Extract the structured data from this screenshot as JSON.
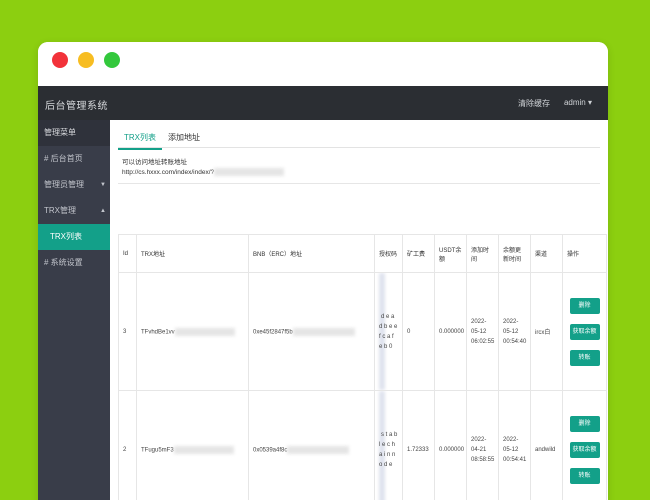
{
  "window": {
    "controls": [
      "close",
      "minimize",
      "maximize"
    ]
  },
  "topnav": {
    "brand": "后台管理系统",
    "links": [
      "清除缓存",
      "admin ▾"
    ]
  },
  "sidebar": {
    "items": [
      {
        "label": "管理菜单",
        "type": "head"
      },
      {
        "label": "# 后台首页"
      },
      {
        "label": "管理员管理",
        "caret": "▼"
      },
      {
        "label": "TRX管理",
        "caret": "▲"
      },
      {
        "label": "TRX列表",
        "type": "sub"
      },
      {
        "label": "# 系统设置"
      }
    ]
  },
  "tabs": [
    {
      "label": "TRX列表",
      "active": true
    },
    {
      "label": "添加地址"
    }
  ],
  "address": {
    "label": "可以访问地址转账地址",
    "url": "http://cs.hxxx.com/index/index/?"
  },
  "table": {
    "columns": [
      "Id",
      "TRX地址",
      "BNB（ERC）地址",
      "授权码",
      "矿工费",
      "USDT余额",
      "添加时间",
      "余额更新时间",
      "渠道",
      "操作"
    ],
    "rows": [
      {
        "id": "3",
        "trx": "TFvhdBe1vv",
        "bnb": "0xe45f2847f5b",
        "auth": "d e a d b e e f c a f e b 0",
        "fee": "0",
        "usdt": "0.000000",
        "added": "2022-05-12 06:02:55",
        "updated": "2022-05-12 00:54:40",
        "channel": "ircx白",
        "actions": [
          "删除",
          "获取余额",
          "转账"
        ]
      },
      {
        "id": "2",
        "trx": "TFugu5mF3",
        "bnb": "0x0539a4f8c",
        "auth": "s t a b l e c h a i n n o d e",
        "fee": "1.72333",
        "usdt": "0.000000",
        "added": "2022-04-21 08:58:55",
        "updated": "2022-05-12 00:54:41",
        "channel": "andwild",
        "actions": [
          "删除",
          "获取余额",
          "转账"
        ]
      }
    ]
  },
  "colors": {
    "accent": "#13a089",
    "sidebar": "#393d49",
    "topnav": "#2b2e33",
    "background": "#8ccf10"
  }
}
